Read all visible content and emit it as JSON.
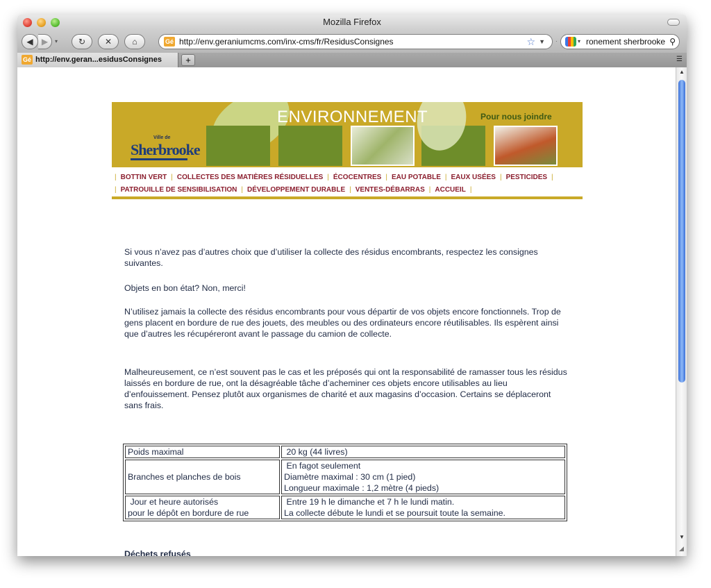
{
  "window": {
    "title": "Mozilla Firefox"
  },
  "toolbar": {
    "url": "http://env.geraniumcms.com/inx-cms/fr/ResidusConsignes",
    "search_value": "ronement sherbrooke",
    "favicon_text": "Gé"
  },
  "tabs": [
    {
      "label": "http://env.geran...esidusConsignes"
    }
  ],
  "banner": {
    "title": "ENVIRONNEMENT",
    "contact": "Pour nous joindre",
    "logo_small": "Ville de",
    "logo_big": "Sherbrooke"
  },
  "menu": {
    "row1": [
      "BOTTIN VERT",
      "COLLECTES DES MATIÈRES RÉSIDUELLES",
      "ÉCOCENTRES",
      "EAU POTABLE",
      "EAUX USÉES",
      "PESTICIDES"
    ],
    "row2": [
      "PATROUILLE DE SENSIBILISATION",
      "DÉVELOPPEMENT DURABLE",
      "VENTES-DÉBARRAS",
      "ACCUEIL"
    ]
  },
  "content": {
    "p1": "Si vous n’avez pas d’autres choix que d’utiliser la collecte des résidus encombrants, respectez les consignes suivantes.",
    "p2": "Objets en bon état? Non, merci!",
    "p3": "N’utilisez jamais la collecte des résidus encombrants pour vous départir de vos objets encore fonctionnels. Trop de gens placent en bordure de rue des jouets, des meubles ou des ordinateurs encore réutilisables. Ils espèrent ainsi que d’autres les récupéreront avant le passage du camion de collecte.",
    "p4": "Malheureusement, ce n’est souvent pas le cas et les préposés qui ont la responsabilité de ramasser tous les résidus laissés en bordure de rue, ont la désagréable tâche d’acheminer ces objets encore utilisables au lieu d’enfouissement. Pensez plutôt aux organismes de charité et aux magasins d’occasion. Certains se déplaceront sans frais.",
    "table": {
      "r1": {
        "label": "Poids maximal",
        "value": "20 kg (44 livres)"
      },
      "r2": {
        "label": "Branches et planches de bois",
        "v1": "En fagot seulement",
        "v2": "Diamètre maximal : 30 cm (1 pied)",
        "v3": "Longueur maximale : 1,2 mètre (4 pieds)"
      },
      "r3": {
        "label1": "Jour et heure autorisés",
        "label2": "pour le dépôt en bordure de rue",
        "v1": "Entre 19 h le dimanche et 7 h le lundi matin.",
        "v2": "La collecte débute le lundi et se poursuit toute la semaine."
      }
    },
    "heading": "Déchets refusés"
  }
}
